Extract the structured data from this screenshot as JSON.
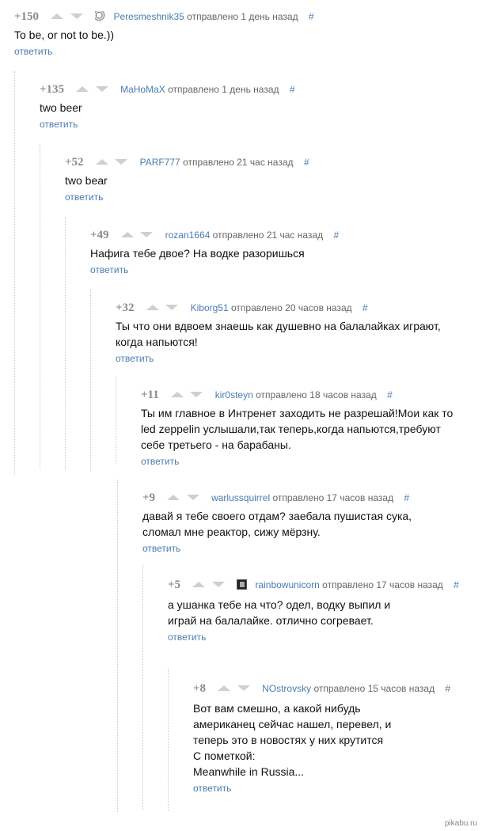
{
  "comments": [
    {
      "rating": "+150",
      "user": "Peresmeshnik35",
      "meta": "отправлено 1 день назад",
      "hash": "#",
      "text": [
        "To be, or not to be.))"
      ],
      "reply": "ответить",
      "avatar": "meme-avatar"
    },
    {
      "rating": "+135",
      "user": "MaHoMaX",
      "meta": "отправлено 1 день назад",
      "hash": "#",
      "text": [
        "two beer"
      ],
      "reply": "ответить"
    },
    {
      "rating": "+52",
      "user": "PARF777",
      "meta": "отправлено 21 час назад",
      "hash": "#",
      "text": [
        "two bear"
      ],
      "reply": "ответить"
    },
    {
      "rating": "+49",
      "user": "rozan1664",
      "meta": "отправлено 21 час назад",
      "hash": "#",
      "text": [
        "Нафига тебе двое? На водке разоришься"
      ],
      "reply": "ответить"
    },
    {
      "rating": "+32",
      "user": "Kiborg51",
      "meta": "отправлено 20 часов назад",
      "hash": "#",
      "text": [
        "Ты что они вдвоем знаешь как душевно на балалайках играют,",
        "когда напьются!"
      ],
      "reply": "ответить"
    },
    {
      "rating": "+11",
      "user": "kir0steyn",
      "meta": "отправлено 18 часов назад",
      "hash": "#",
      "text": [
        "Ты им главное в Интренет заходить не разрешай!Мои как то",
        "led zeppelin услышали,так теперь,когда напьются,требуют",
        "себе третьего - на барабаны."
      ],
      "reply": "ответить"
    },
    {
      "rating": "+9",
      "user": "warlussquirrel",
      "meta": "отправлено 17 часов назад",
      "hash": "#",
      "text": [
        "давай я тебе своего отдам? заебала пушистая сука,",
        "сломал мне реактор, сижу мёрзну."
      ],
      "reply": "ответить"
    },
    {
      "rating": "+5",
      "user": "rainbowunicorn",
      "meta": "отправлено 17 часов назад",
      "hash": "#",
      "text": [
        "а ушанка тебе на что? одел, водку выпил и",
        "играй на балалайке. отлично согревает."
      ],
      "reply": "ответить",
      "avatar": "unicorn-avatar"
    },
    {
      "rating": "+8",
      "user": "NOstrovsky",
      "meta": "отправлено 15 часов назад",
      "hash": "#",
      "text": [
        "Вот вам смешно, а какой нибудь",
        "американец сейчас нашел, перевел, и",
        "теперь это в новостях у них крутится",
        "С пометкой:",
        "Meanwhile in Russia..."
      ],
      "reply": "ответить"
    }
  ],
  "watermark": "pikabu.ru"
}
